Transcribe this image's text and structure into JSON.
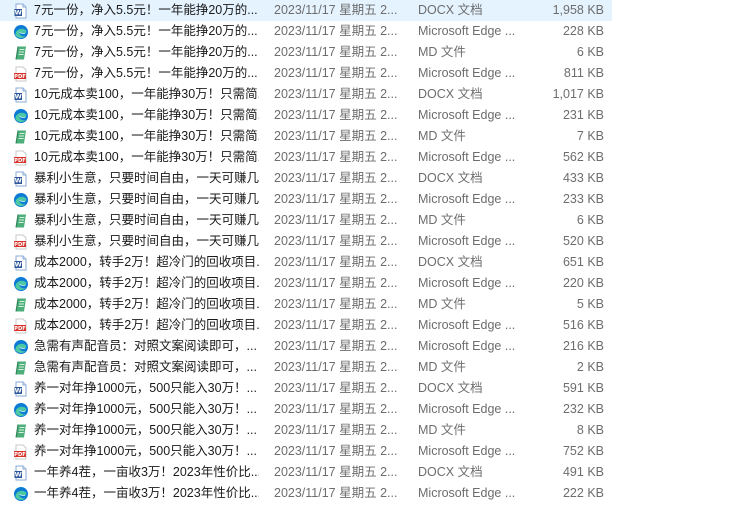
{
  "colors": {
    "docx_icon": "#2b579a",
    "edge_icon": "#0c7bd6",
    "md_icon": "#4caf7a",
    "pdf_icon": "#d9342b"
  },
  "files": [
    {
      "icon": "docx",
      "name": "7元一份，净入5.5元！一年能挣20万的...",
      "date": "2023/11/17 星期五 2...",
      "type": "DOCX 文档",
      "size": "1,958 KB"
    },
    {
      "icon": "edge",
      "name": "7元一份，净入5.5元！一年能挣20万的...",
      "date": "2023/11/17 星期五 2...",
      "type": "Microsoft Edge ...",
      "size": "228 KB"
    },
    {
      "icon": "md",
      "name": "7元一份，净入5.5元！一年能挣20万的...",
      "date": "2023/11/17 星期五 2...",
      "type": "MD 文件",
      "size": "6 KB"
    },
    {
      "icon": "pdf",
      "name": "7元一份，净入5.5元！一年能挣20万的...",
      "date": "2023/11/17 星期五 2...",
      "type": "Microsoft Edge ...",
      "size": "811 KB"
    },
    {
      "icon": "docx",
      "name": "10元成本卖100，一年能挣30万！只需简...",
      "date": "2023/11/17 星期五 2...",
      "type": "DOCX 文档",
      "size": "1,017 KB"
    },
    {
      "icon": "edge",
      "name": "10元成本卖100，一年能挣30万！只需简...",
      "date": "2023/11/17 星期五 2...",
      "type": "Microsoft Edge ...",
      "size": "231 KB"
    },
    {
      "icon": "md",
      "name": "10元成本卖100，一年能挣30万！只需简...",
      "date": "2023/11/17 星期五 2...",
      "type": "MD 文件",
      "size": "7 KB"
    },
    {
      "icon": "pdf",
      "name": "10元成本卖100，一年能挣30万！只需简...",
      "date": "2023/11/17 星期五 2...",
      "type": "Microsoft Edge ...",
      "size": "562 KB"
    },
    {
      "icon": "docx",
      "name": "暴利小生意，只要时间自由，一天可赚几...",
      "date": "2023/11/17 星期五 2...",
      "type": "DOCX 文档",
      "size": "433 KB"
    },
    {
      "icon": "edge",
      "name": "暴利小生意，只要时间自由，一天可赚几...",
      "date": "2023/11/17 星期五 2...",
      "type": "Microsoft Edge ...",
      "size": "233 KB"
    },
    {
      "icon": "md",
      "name": "暴利小生意，只要时间自由，一天可赚几...",
      "date": "2023/11/17 星期五 2...",
      "type": "MD 文件",
      "size": "6 KB"
    },
    {
      "icon": "pdf",
      "name": "暴利小生意，只要时间自由，一天可赚几...",
      "date": "2023/11/17 星期五 2...",
      "type": "Microsoft Edge ...",
      "size": "520 KB"
    },
    {
      "icon": "docx",
      "name": "成本2000，转手2万！超冷门的回收项目...",
      "date": "2023/11/17 星期五 2...",
      "type": "DOCX 文档",
      "size": "651 KB"
    },
    {
      "icon": "edge",
      "name": "成本2000，转手2万！超冷门的回收项目...",
      "date": "2023/11/17 星期五 2...",
      "type": "Microsoft Edge ...",
      "size": "220 KB"
    },
    {
      "icon": "md",
      "name": "成本2000，转手2万！超冷门的回收项目...",
      "date": "2023/11/17 星期五 2...",
      "type": "MD 文件",
      "size": "5 KB"
    },
    {
      "icon": "pdf",
      "name": "成本2000，转手2万！超冷门的回收项目...",
      "date": "2023/11/17 星期五 2...",
      "type": "Microsoft Edge ...",
      "size": "516 KB"
    },
    {
      "icon": "edge",
      "name": "急需有声配音员：对照文案阅读即可，...",
      "date": "2023/11/17 星期五 2...",
      "type": "Microsoft Edge ...",
      "size": "216 KB"
    },
    {
      "icon": "md",
      "name": "急需有声配音员：对照文案阅读即可，...",
      "date": "2023/11/17 星期五 2...",
      "type": "MD 文件",
      "size": "2 KB"
    },
    {
      "icon": "docx",
      "name": "养一对年挣1000元，500只能入30万！...",
      "date": "2023/11/17 星期五 2...",
      "type": "DOCX 文档",
      "size": "591 KB"
    },
    {
      "icon": "edge",
      "name": "养一对年挣1000元，500只能入30万！...",
      "date": "2023/11/17 星期五 2...",
      "type": "Microsoft Edge ...",
      "size": "232 KB"
    },
    {
      "icon": "md",
      "name": "养一对年挣1000元，500只能入30万！...",
      "date": "2023/11/17 星期五 2...",
      "type": "MD 文件",
      "size": "8 KB"
    },
    {
      "icon": "pdf",
      "name": "养一对年挣1000元，500只能入30万！...",
      "date": "2023/11/17 星期五 2...",
      "type": "Microsoft Edge ...",
      "size": "752 KB"
    },
    {
      "icon": "docx",
      "name": "一年养4茬，一亩收3万！2023年性价比...",
      "date": "2023/11/17 星期五 2...",
      "type": "DOCX 文档",
      "size": "491 KB"
    },
    {
      "icon": "edge",
      "name": "一年养4茬，一亩收3万！2023年性价比...",
      "date": "2023/11/17 星期五 2...",
      "type": "Microsoft Edge ...",
      "size": "222 KB"
    }
  ]
}
